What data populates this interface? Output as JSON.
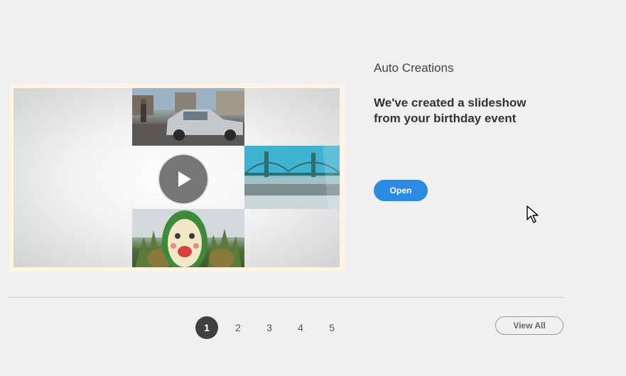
{
  "section": {
    "title": "Auto Creations"
  },
  "creation": {
    "headline": "We've created a slideshow from your birthday event",
    "open_label": "Open"
  },
  "pager": {
    "pages": [
      "1",
      "2",
      "3",
      "4",
      "5"
    ],
    "active_page": "1",
    "view_all_label": "View All"
  },
  "colors": {
    "accent": "#2a8be2",
    "pager_active": "#404040",
    "background": "#f0f0f0"
  },
  "icons": {
    "play": "play-icon",
    "cursor": "mouse-pointer-icon"
  }
}
